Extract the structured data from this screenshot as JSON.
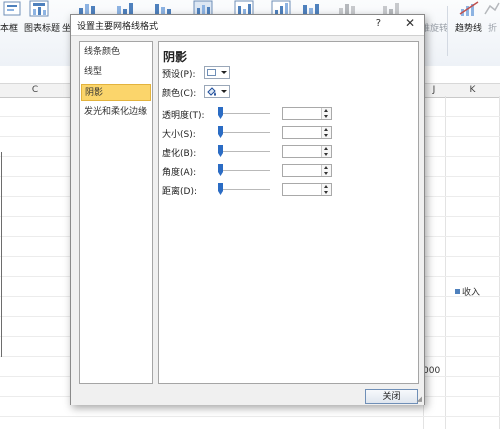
{
  "ribbon": {
    "labels": {
      "text_box": "本框",
      "chart_title": "图表标题",
      "coordinate_partial": "坐",
      "rotate_partial": "三维旋转",
      "trendline": "趋势线",
      "polyline_partial": "折"
    },
    "colors": {
      "accent": "#4f81bd",
      "disabled": "#9aa0a8"
    }
  },
  "sheet": {
    "columns": [
      "C",
      "J",
      "K"
    ],
    "legend": "收入",
    "axis_tail": "000"
  },
  "dialog": {
    "title": "设置主要网格线格式",
    "help": "?",
    "close": "✕",
    "nav": [
      "线条颜色",
      "线型",
      "阴影",
      "发光和柔化边缘"
    ],
    "selected_nav_index": 2,
    "panel_title": "阴影",
    "preset_label": "预设(P):",
    "color_label": "颜色(C):",
    "rows": [
      {
        "label": "透明度(T):",
        "value": ""
      },
      {
        "label": "大小(S):",
        "value": ""
      },
      {
        "label": "虚化(B):",
        "value": ""
      },
      {
        "label": "角度(A):",
        "value": ""
      },
      {
        "label": "距离(D):",
        "value": ""
      }
    ],
    "close_button": "关闭"
  }
}
